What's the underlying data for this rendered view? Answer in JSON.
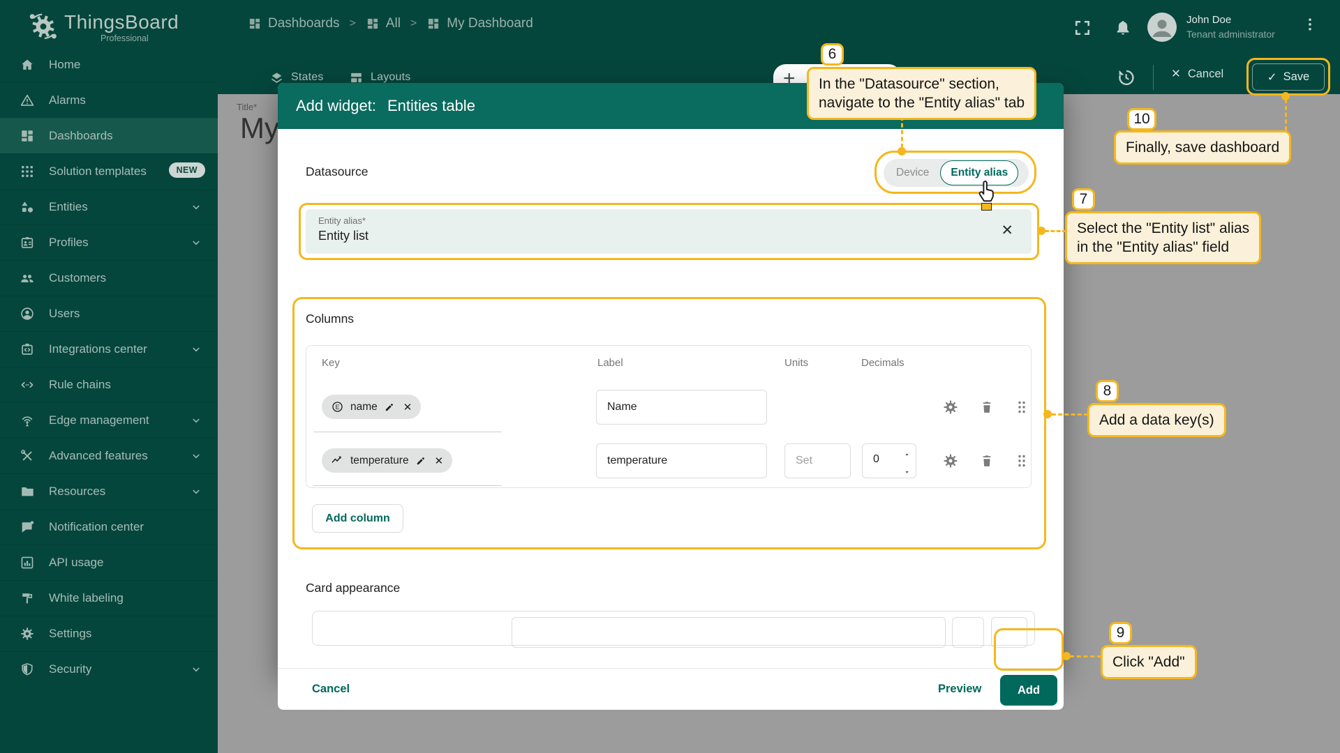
{
  "app": {
    "brand": "ThingsBoard",
    "brand_sub": "Professional"
  },
  "topbar": {
    "breadcrumbs": [
      {
        "label": "Dashboards"
      },
      {
        "label": "All"
      },
      {
        "label": "My Dashboard"
      }
    ],
    "user": {
      "name": "John Doe",
      "role": "Tenant administrator"
    }
  },
  "toolbar": {
    "states_label": "States",
    "layouts_label": "Layouts",
    "cancel_label": "Cancel",
    "save_label": "Save"
  },
  "sidebar": {
    "items": [
      {
        "label": "Home",
        "icon": "home"
      },
      {
        "label": "Alarms",
        "icon": "alarm"
      },
      {
        "label": "Dashboards",
        "icon": "dashboards",
        "active": true
      },
      {
        "label": "Solution templates",
        "icon": "solution-templates",
        "badge": "NEW"
      },
      {
        "label": "Entities",
        "icon": "entities",
        "chevron": true
      },
      {
        "label": "Profiles",
        "icon": "profiles",
        "chevron": true
      },
      {
        "label": "Customers",
        "icon": "customers"
      },
      {
        "label": "Users",
        "icon": "users"
      },
      {
        "label": "Integrations center",
        "icon": "integrations",
        "chevron": true
      },
      {
        "label": "Rule chains",
        "icon": "rule-chains"
      },
      {
        "label": "Edge management",
        "icon": "edge",
        "chevron": true
      },
      {
        "label": "Advanced features",
        "icon": "advanced",
        "chevron": true
      },
      {
        "label": "Resources",
        "icon": "resources",
        "chevron": true
      },
      {
        "label": "Notification center",
        "icon": "notification"
      },
      {
        "label": "API usage",
        "icon": "api-usage"
      },
      {
        "label": "White labeling",
        "icon": "white-labeling"
      },
      {
        "label": "Settings",
        "icon": "settings"
      },
      {
        "label": "Security",
        "icon": "security",
        "chevron": true
      }
    ]
  },
  "canvas": {
    "title_label": "Title*",
    "title_value": "My"
  },
  "modal": {
    "title_prefix": "Add widget:",
    "title_name": "Entities table",
    "datasource": {
      "heading": "Datasource",
      "tabs": [
        {
          "label": "Device",
          "selected": false
        },
        {
          "label": "Entity alias",
          "selected": true
        }
      ],
      "alias_label": "Entity alias*",
      "alias_value": "Entity list"
    },
    "columns": {
      "heading": "Columns",
      "headers": [
        "Key",
        "Label",
        "Units",
        "Decimals"
      ],
      "rows": [
        {
          "key": "name",
          "key_icon": "entity-field",
          "label": "Name",
          "units": null,
          "decimals": null
        },
        {
          "key": "temperature",
          "key_icon": "timeseries",
          "label": "temperature",
          "units_placeholder": "Set",
          "units": "",
          "decimals": "0"
        }
      ],
      "add_column_label": "Add column"
    },
    "card_appearance": {
      "heading": "Card appearance"
    },
    "footer": {
      "cancel": "Cancel",
      "preview": "Preview",
      "add": "Add"
    }
  },
  "annotations": {
    "six": {
      "num": "6",
      "line1": "In the \"Datasource\" section,",
      "line2": "navigate to the \"Entity alias\" tab"
    },
    "seven": {
      "num": "7",
      "line1": "Select the \"Entity list\" alias",
      "line2": "in the \"Entity alias\" field"
    },
    "eight": {
      "num": "8",
      "line1": "Add a data key(s)"
    },
    "nine": {
      "num": "9",
      "line1": "Click \"Add\""
    },
    "ten": {
      "num": "10",
      "line1": "Finally, save dashboard"
    }
  },
  "colors": {
    "accent_teal": "#00695C",
    "annotation_yellow": "#F4B71E",
    "sidebar_bg": "#05463C",
    "modal_header": "#0A6B5F",
    "backdrop": "#9C9C9C"
  }
}
